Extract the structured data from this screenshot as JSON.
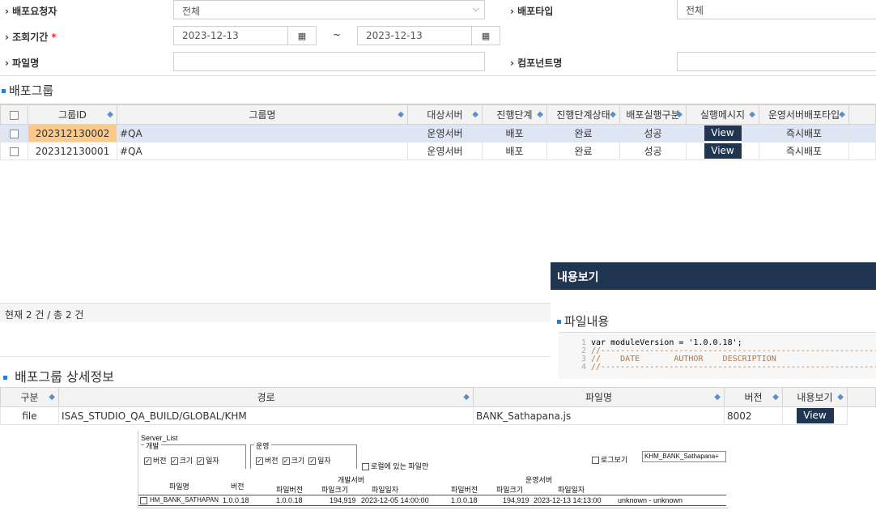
{
  "search": {
    "requester_label": "배포요청자",
    "requester_value": "전체",
    "deploy_type_label": "배포타입",
    "deploy_type_value": "전체",
    "period_label": "조회기간",
    "period_required": "*",
    "date_from": "2023-12-13",
    "date_tilde": "~",
    "date_to": "2023-12-13",
    "file_label": "파일명",
    "component_label": "컴포넌트명"
  },
  "group": {
    "section_title": "배포그룹",
    "columns": [
      "그룹ID",
      "그룹명",
      "대상서버",
      "진행단계",
      "진행단계상태",
      "배포실행구분",
      "실행메시지",
      "운영서버배포타입"
    ],
    "rows": [
      {
        "id": "202312130002",
        "name": "#QA",
        "server": "운영서버",
        "step": "배포",
        "status": "완료",
        "result": "성공",
        "view": "View",
        "type": "즉시배포"
      },
      {
        "id": "202312130001",
        "name": "#QA",
        "server": "운영서버",
        "step": "배포",
        "status": "완료",
        "result": "성공",
        "view": "View",
        "type": "즉시배포"
      }
    ],
    "footer": "현재 2 건 / 총 2 건"
  },
  "popup": {
    "title": "내용보기",
    "section": "파일내용",
    "lines": [
      {
        "n": "1",
        "t": "var moduleVersion = '1.0.0.18';"
      },
      {
        "n": "2",
        "t": "//-----------------------------------------------------------------------------------"
      },
      {
        "n": "3",
        "t": "//    DATE       AUTHOR    DESCRIPTION"
      },
      {
        "n": "4",
        "t": "//-----------------------------------------------------------------------------------"
      }
    ]
  },
  "detail": {
    "section_title": "배포그룹 상세정보",
    "columns": [
      "구분",
      "경로",
      "파일명",
      "버전",
      "내용보기"
    ],
    "row": {
      "kind": "file",
      "path": "ISAS_STUDIO_QA_BUILD/GLOBAL/KHM",
      "file": "BANK_Sathapana.js",
      "version": "8002",
      "view": "View"
    }
  },
  "server_list": {
    "title": "Server_List",
    "dev_group": "개발",
    "op_group": "운영",
    "opt_version": "버전",
    "opt_size": "크기",
    "opt_date": "일자",
    "local_only": "로컬에 있는 파일만",
    "log_view": "로그보기",
    "log_value": "KHM_BANK_Sathapana+",
    "h_file": "파일명",
    "h_version": "버전",
    "h_dev": "개발서버",
    "h_op": "운영서버",
    "h_fver": "파일버전",
    "h_fsize": "파일크기",
    "h_fdate": "파일일자",
    "row": {
      "file": "HM_BANK_SATHAPAN",
      "version": "1.0.0.18",
      "dev_ver": "1.0.0.18",
      "dev_size": "194,919",
      "dev_date": "2023-12-05 14:00:00",
      "op_ver": "1.0.0.18",
      "op_size": "194,919",
      "op_date": "2023-12-13 14:13:00",
      "note": "unknown - unknown"
    }
  }
}
